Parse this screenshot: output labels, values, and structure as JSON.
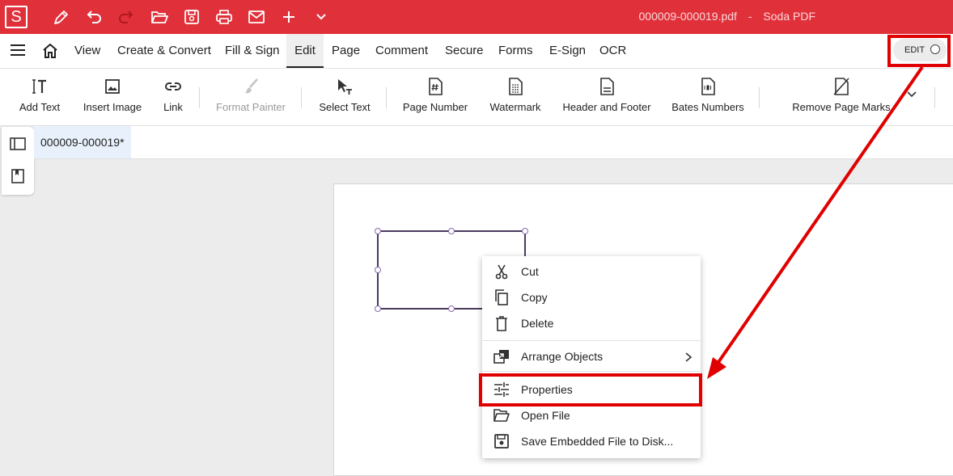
{
  "titlebar": {
    "logo_letter": "S",
    "document_name": "000009-000019.pdf",
    "separator": "-",
    "app_name": "Soda PDF",
    "quick_access": [
      "pen-icon",
      "undo-icon",
      "redo-icon",
      "open-folder-icon",
      "save-icon",
      "print-icon",
      "mail-icon",
      "plus-icon",
      "chevron-down-icon"
    ]
  },
  "menu": {
    "items": [
      "View",
      "Create & Convert",
      "Fill & Sign",
      "Edit",
      "Page",
      "Comment",
      "Secure",
      "Forms",
      "E-Sign",
      "OCR"
    ],
    "active": "Edit",
    "edit_toggle_label": "EDIT"
  },
  "toolbar": {
    "tools": [
      {
        "label": "Add Text",
        "icon": "add-text-icon",
        "enabled": true
      },
      {
        "label": "Insert Image",
        "icon": "image-icon",
        "enabled": true
      },
      {
        "label": "Link",
        "icon": "link-icon",
        "enabled": true
      },
      {
        "label": "Format Painter",
        "icon": "brush-icon",
        "enabled": false
      },
      {
        "label": "Select Text",
        "icon": "select-text-icon",
        "enabled": true
      },
      {
        "label": "Page Number",
        "icon": "page-number-icon",
        "enabled": true
      },
      {
        "label": "Watermark",
        "icon": "watermark-icon",
        "enabled": true
      },
      {
        "label": "Header and Footer",
        "icon": "header-footer-icon",
        "enabled": true
      },
      {
        "label": "Bates Numbers",
        "icon": "bates-numbers-icon",
        "enabled": true
      },
      {
        "label": "Remove Page Marks",
        "icon": "remove-marks-icon",
        "enabled": true
      }
    ]
  },
  "document_tab": {
    "label": "000009-000019*"
  },
  "context_menu": {
    "items": [
      {
        "label": "Cut",
        "icon": "scissors-icon"
      },
      {
        "label": "Copy",
        "icon": "copy-icon"
      },
      {
        "label": "Delete",
        "icon": "trash-icon"
      },
      {
        "label": "Arrange Objects",
        "icon": "arrange-icon",
        "has_submenu": true
      },
      {
        "label": "Properties",
        "icon": "sliders-icon",
        "highlighted": true
      },
      {
        "label": "Open File",
        "icon": "folder-icon"
      },
      {
        "label": "Save Embedded File to Disk...",
        "icon": "save-disk-icon"
      }
    ]
  },
  "colors": {
    "brand": "#e0313b",
    "annotation": "#e00000",
    "selection": "#5c3c7a"
  }
}
